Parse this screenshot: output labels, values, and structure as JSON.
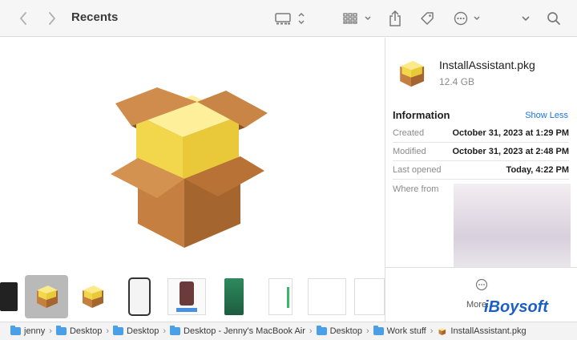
{
  "toolbar": {
    "title": "Recents",
    "back_icon": "chevron-left-icon",
    "forward_icon": "chevron-right-icon",
    "view_icon": "gallery-view-icon",
    "group_icon": "grid-group-icon",
    "share_icon": "share-icon",
    "tag_icon": "tag-icon",
    "action_icon": "ellipsis-circle-icon",
    "expand_icon": "chevron-down-icon",
    "search_icon": "search-icon"
  },
  "inspector": {
    "file_name": "InstallAssistant.pkg",
    "file_size": "12.4 GB",
    "information_title": "Information",
    "show_less": "Show Less",
    "rows": [
      {
        "key": "Created",
        "value": "October 31, 2023 at 1:29 PM"
      },
      {
        "key": "Modified",
        "value": "October 31, 2023 at 2:48 PM"
      },
      {
        "key": "Last opened",
        "value": "Today, 4:22 PM"
      }
    ],
    "where_from_label": "Where from",
    "more_label": "More...",
    "watermark": "iBoysoft"
  },
  "pathbar": {
    "items": [
      "jenny",
      "Desktop",
      "Desktop",
      "Desktop - Jenny's MacBook Air",
      "Desktop",
      "Work stuff",
      "InstallAssistant.pkg"
    ]
  },
  "colors": {
    "accent": "#1a73e8",
    "folder": "#4b9fe6",
    "box_brown": "#b8763c",
    "box_yellow": "#f2d64b"
  }
}
